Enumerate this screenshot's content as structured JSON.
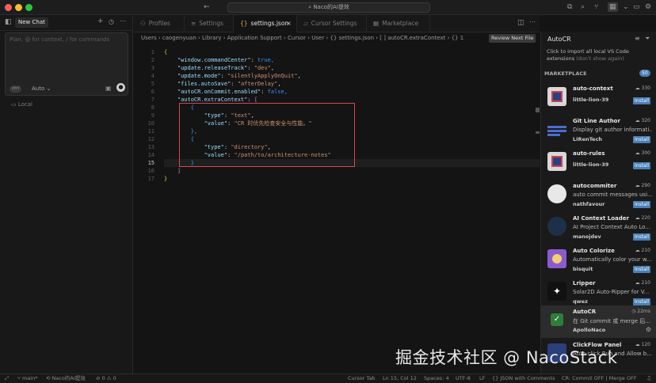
{
  "window": {
    "title": "Naco的AI提效"
  },
  "chat": {
    "tab_label": "New Chat",
    "placeholder": "Plan, @ for context, / for commands",
    "mode_badge": "ctrl",
    "mode": "Auto",
    "scope": "Local"
  },
  "tabs": [
    {
      "label": "Profiles"
    },
    {
      "label": "Settings"
    },
    {
      "label": "settings.json"
    },
    {
      "label": "Cursor Settings"
    },
    {
      "label": "Marketplace"
    }
  ],
  "breadcrumb": "Users › caogenyuan › Library › Application Support › Cursor › User › {} settings.json › [ ] autoCR.extraContext › {} 1",
  "review_button": "Review Next File",
  "code": {
    "lines": [
      "1",
      "2",
      "3",
      "4",
      "5",
      "6",
      "7",
      "8",
      "9",
      "10",
      "11",
      "12",
      "13",
      "14",
      "15",
      "16",
      "17"
    ],
    "l1": "{",
    "l2k": "\"window.commandCenter\"",
    "l2v": "true,",
    "l3k": "\"update.releaseTrack\"",
    "l3v": "\"dev\"",
    "l4k": "\"update.mode\"",
    "l4v": "\"silentlyApplyOnQuit\"",
    "l5k": "\"files.autoSave\"",
    "l5v": "\"afterDelay\"",
    "l6k": "\"autoCR.onCommit.enabled\"",
    "l6v": "false,",
    "l7k": "\"autoCR.extraContext\"",
    "l7v": "[",
    "l8": "{",
    "l9k": "\"type\"",
    "l9v": "\"text\"",
    "l10k": "\"value\"",
    "l10v": "\"CR 时优先检查安全与性能。\"",
    "l11": "},",
    "l12": "{",
    "l13k": "\"type\"",
    "l13v": "\"directory\"",
    "l14k": "\"value\"",
    "l14v": "\"/path/to/architecture-notes\"",
    "l15": "}",
    "l16": "]",
    "l17": "}"
  },
  "extensions": {
    "search": "AutoCR",
    "import_link": "Click to import all local VS Code extensions",
    "import_note": "(don't show again)",
    "section": "MARKETPLACE",
    "count": "50",
    "items": [
      {
        "name": "auto-context",
        "desc": "",
        "author": "little-lion-39",
        "count": "330",
        "action": "Install",
        "color": "#d8d8d8"
      },
      {
        "name": "Git Line Author",
        "desc": "Display git author informati...",
        "author": "LIRenTech",
        "count": "320",
        "action": "Install",
        "color": "#3c5fb8"
      },
      {
        "name": "auto-rules",
        "desc": "",
        "author": "little-lion-39",
        "count": "300",
        "action": "Install",
        "color": "#d8d8d8"
      },
      {
        "name": "autocommiter",
        "desc": "auto commit messages usi...",
        "author": "nathfavour",
        "count": "290",
        "action": "Install",
        "color": "#e8e8e8"
      },
      {
        "name": "AI Context Loader",
        "desc": "AI Project Context Auto Lo...",
        "author": "manojdev",
        "count": "220",
        "action": "Install",
        "color": "#1e2f4a"
      },
      {
        "name": "Auto Colorize",
        "desc": "Automatically color your w...",
        "author": "bisquit",
        "count": "210",
        "action": "Install",
        "color": "#8a5bd0"
      },
      {
        "name": "Lripper",
        "desc": "Solar2D Auto-Ripper for V...",
        "author": "qwez",
        "count": "210",
        "action": "Install",
        "color": "#111111"
      },
      {
        "name": "AutoCR",
        "desc": "在 Git commit 或 merge 后...",
        "author": "ApolloNaco",
        "count": "22ms",
        "action": "",
        "color": "#2f7d3a"
      },
      {
        "name": "ClickFlow Panel",
        "desc": "Auto-click Run and Allow b...",
        "author": "",
        "count": "120",
        "action": "",
        "color": "#2b3f7a"
      }
    ]
  },
  "status": {
    "branch": "main*",
    "project": "Naco的AI提效",
    "problems": "⊘ 0 ⚠ 0",
    "cursor_tab": "Cursor Tab",
    "position": "Ln 15, Col 12",
    "spaces": "Spaces: 4",
    "encoding": "UTF-8",
    "eol": "LF",
    "language": "{} JSON with Comments",
    "cr_status": "CR: Commit OFF | Merge OFF"
  },
  "watermark": "掘金技术社区 @ NacoStack",
  "colors": {
    "accent": "#3794ff",
    "highlight_box": "#e0434d",
    "install": "#4a7fb5"
  }
}
